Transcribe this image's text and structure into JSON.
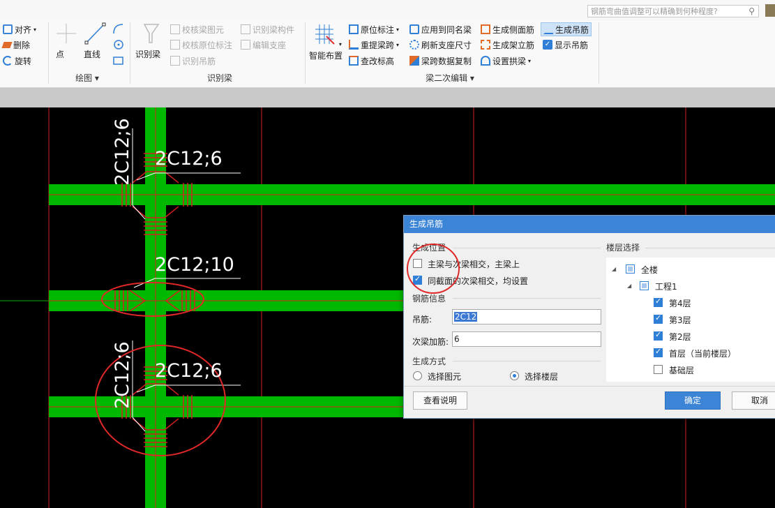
{
  "search": {
    "placeholder": "钢筋弯曲值调整可以精确到何种程度?"
  },
  "ribbon": {
    "align_label": "对齐",
    "delete_label": "删除",
    "rotate_label": "旋转",
    "point_label": "点",
    "line_label": "直线",
    "draw_group": "绘图",
    "recognize_beam_label": "识别梁",
    "check_beam_label": "校核梁图元",
    "check_orig_label": "校核原位标注",
    "recognize_hanger_label": "识别吊筋",
    "recognize_components_label": "识别梁构件",
    "edit_support_label": "编辑支座",
    "recognize_group": "识别梁",
    "smart_layout_label": "智能布置",
    "orig_mark_label": "原位标注",
    "reextract_span_label": "重提梁跨",
    "check_elev_label": "查改标高",
    "apply_same_label": "应用到同名梁",
    "refresh_support_label": "刷新支座尺寸",
    "copy_span_label": "梁跨数据复制",
    "gen_side_label": "生成侧面筋",
    "gen_frame_label": "生成架立筋",
    "set_arch_label": "设置拱梁",
    "gen_hanger_label": "生成吊筋",
    "show_hanger_label": "显示吊筋",
    "secondary_group": "梁二次编辑"
  },
  "canvas": {
    "label_1": "2C12;6",
    "label_2": "2C12;6",
    "label_3": "2C12;10",
    "label_4": "2C12;6",
    "label_5": "2C12;6"
  },
  "dialog": {
    "title": "生成吊筋",
    "position_section": "生成位置",
    "opt_main_secondary": "主梁与次梁相交，主梁上",
    "opt_same_section": "同截面的次梁相交，均设置",
    "opt_main_secondary_checked": false,
    "opt_same_section_checked": true,
    "rebar_section": "钢筋信息",
    "hanger_label": "吊筋:",
    "hanger_value": "2C12",
    "secondary_add_label": "次梁加筋:",
    "secondary_add_value": "6",
    "method_section": "生成方式",
    "method_select_element": "选择图元",
    "method_select_floor": "选择楼层",
    "method_selected": "选择楼层",
    "floor_section": "楼层选择",
    "tree": {
      "all": "全楼",
      "project": "工程1",
      "floors": [
        {
          "name": "第4层",
          "checked": true
        },
        {
          "name": "第3层",
          "checked": true
        },
        {
          "name": "第2层",
          "checked": true
        },
        {
          "name": "首层（当前楼层）",
          "checked": true
        },
        {
          "name": "基础层",
          "checked": false
        }
      ]
    },
    "help_button": "查看说明",
    "ok_button": "确定",
    "cancel_button": "取消"
  },
  "colors": {
    "beam_green": "#00b800",
    "axis_red": "#d42020",
    "accent_blue": "#3c84d6",
    "annotation_circle": "#e02828"
  }
}
